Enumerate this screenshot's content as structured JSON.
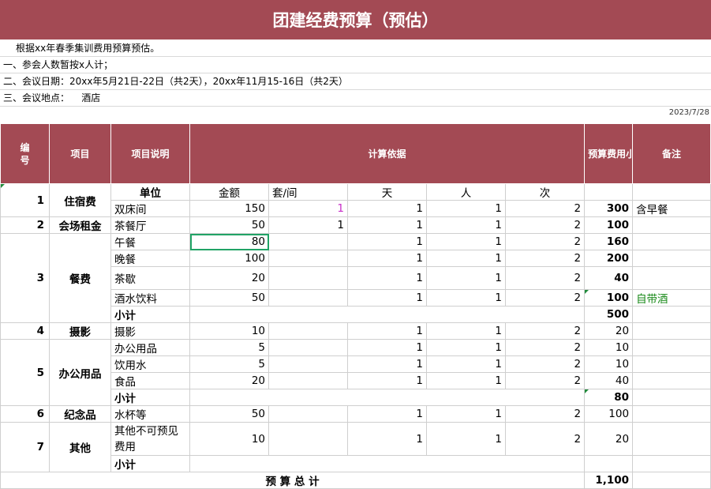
{
  "title": "团建经费预算（预估）",
  "notes": [
    "根据xx年春季集训费用预算预估。",
    "一、参会人数暂按x人计；",
    "二、会议日期：20xx年5月21日-22日（共2天），20xx年11月15-16日（共2天）",
    "三、会议地点：    酒店"
  ],
  "date": "2023/7/28",
  "header": {
    "no": "编号",
    "item": "项目",
    "desc": "项目说明",
    "basis": "计算依据",
    "subtotal": "预算费用小计",
    "remark": "备注"
  },
  "sub_header": {
    "unit": "单位",
    "amount": "金额",
    "set": "套/间",
    "day": "天",
    "person": "人",
    "times": "次"
  },
  "rows": [
    {
      "no": "1",
      "item": "住宿费",
      "desc": "双床间",
      "amount": "150",
      "set": "1",
      "day": "1",
      "person": "1",
      "times": "2",
      "subtotal": "300",
      "remark": "含早餐"
    },
    {
      "no": "2",
      "item": "会场租金",
      "desc": "茶餐厅",
      "amount": "50",
      "set": "1",
      "day": "1",
      "person": "1",
      "times": "2",
      "subtotal": "100",
      "remark": ""
    },
    {
      "no": "3",
      "item": "餐费",
      "desc": "午餐",
      "amount": "80",
      "set": "",
      "day": "1",
      "person": "1",
      "times": "2",
      "subtotal": "160",
      "remark": ""
    },
    {
      "desc": "晚餐",
      "amount": "100",
      "set": "",
      "day": "1",
      "person": "1",
      "times": "2",
      "subtotal": "200",
      "remark": ""
    },
    {
      "desc": "茶歇",
      "amount": "20",
      "set": "",
      "day": "1",
      "person": "1",
      "times": "2",
      "subtotal": "40",
      "remark": ""
    },
    {
      "desc": "酒水饮料",
      "amount": "50",
      "set": "",
      "day": "1",
      "person": "1",
      "times": "2",
      "subtotal": "100",
      "remark": "自带酒"
    },
    {
      "desc": "小计",
      "subtotal": "500"
    },
    {
      "no": "4",
      "item": "摄影",
      "desc": "摄影",
      "amount": "10",
      "set": "",
      "day": "1",
      "person": "1",
      "times": "2",
      "subtotal": "20",
      "remark": ""
    },
    {
      "no": "5",
      "item": "办公用品",
      "desc": "办公用品",
      "amount": "5",
      "set": "",
      "day": "1",
      "person": "1",
      "times": "2",
      "subtotal": "10",
      "remark": ""
    },
    {
      "desc": "饮用水",
      "amount": "5",
      "set": "",
      "day": "1",
      "person": "1",
      "times": "2",
      "subtotal": "10",
      "remark": ""
    },
    {
      "desc": "食品",
      "amount": "20",
      "set": "",
      "day": "1",
      "person": "1",
      "times": "2",
      "subtotal": "40",
      "remark": ""
    },
    {
      "desc": "小计",
      "subtotal": "80"
    },
    {
      "no": "6",
      "item": "纪念品",
      "desc": "水杯等",
      "amount": "50",
      "set": "",
      "day": "1",
      "person": "1",
      "times": "2",
      "subtotal": "100",
      "remark": ""
    },
    {
      "no": "7",
      "item": "其他",
      "desc": "其他不可预见费用",
      "amount": "10",
      "set": "",
      "day": "1",
      "person": "1",
      "times": "2",
      "subtotal": "20",
      "remark": ""
    },
    {
      "desc": "小计",
      "subtotal": ""
    }
  ],
  "total": {
    "label": "预 算 总 计",
    "value": "1,100"
  }
}
